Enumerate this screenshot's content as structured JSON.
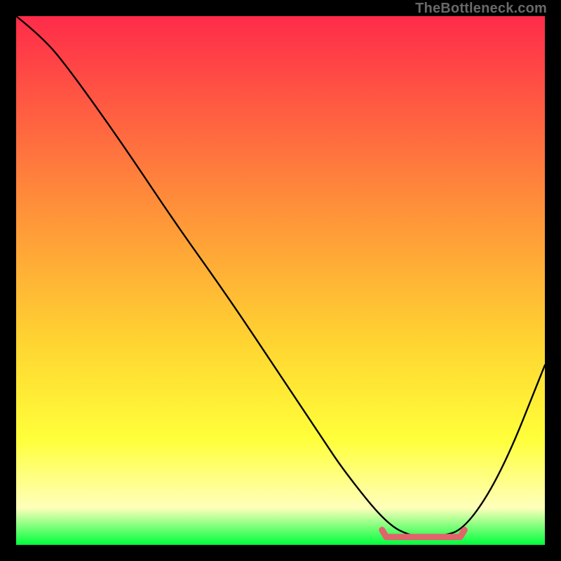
{
  "attribution": "TheBottleneck.com",
  "colors": {
    "top": "#ff2b4a",
    "mid1": "#ff8d3a",
    "mid2": "#ffd531",
    "mid3": "#ffff3a",
    "mid4": "#ffffbb",
    "bottom": "#00ff3c",
    "curve": "#000000",
    "highlight": "#e0646b"
  },
  "chart_data": {
    "type": "line",
    "title": "",
    "xlabel": "",
    "ylabel": "",
    "xlim": [
      0,
      100
    ],
    "ylim": [
      0,
      100
    ],
    "series": [
      {
        "name": "bottleneck-curve",
        "x": [
          0,
          5,
          10,
          20,
          30,
          40,
          50,
          58,
          62,
          70,
          75,
          80,
          85,
          92,
          100
        ],
        "values": [
          100,
          96,
          90,
          76,
          61,
          47,
          32,
          20,
          14,
          4,
          1.5,
          1.5,
          3,
          14,
          34
        ]
      }
    ],
    "annotations": [
      {
        "name": "optimal-range",
        "x_from": 70,
        "x_to": 84,
        "y": 1.5
      }
    ]
  }
}
